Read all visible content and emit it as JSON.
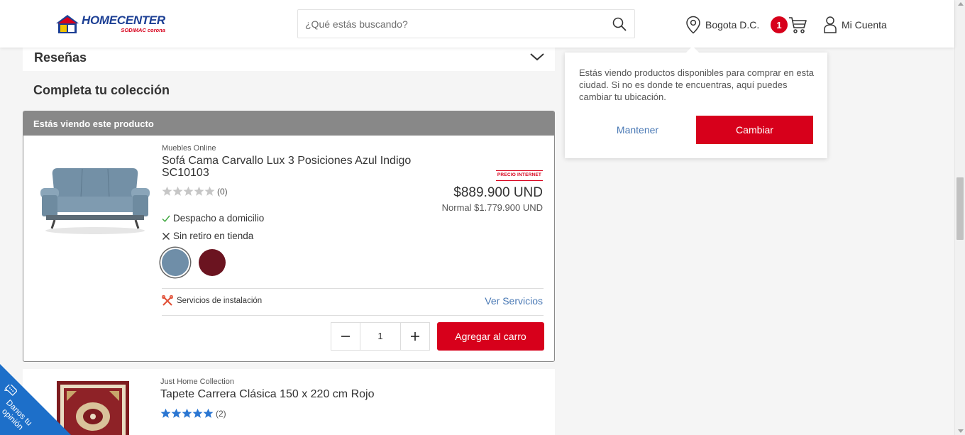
{
  "header": {
    "logo_main": "HOMECENTER",
    "logo_sub": "SODIMAC corona",
    "search_placeholder": "¿Qué estás buscando?",
    "location": "Bogota D.C.",
    "cart_count": "1",
    "account": "Mi Cuenta"
  },
  "sections": {
    "reviews": "Reseñas",
    "collection": "Completa tu colección",
    "viewing_header": "Estás viendo este producto"
  },
  "product1": {
    "brand": "Muebles Online",
    "name": "Sofá Cama Carvallo Lux 3 Posiciones Azul Indigo SC10103",
    "rating": 0,
    "rating_count": "(0)",
    "price_badge": "PRECIO INTERNET",
    "price": "$889.900 UND",
    "normal_price": "Normal $1.779.900  UND",
    "shipping": "Despacho a domicilio",
    "pickup": "Sin retiro en tienda",
    "colors": [
      "#6f8ea8",
      "#6b1420"
    ],
    "selected_color": 0,
    "services_label": "Servicios de instalación",
    "services_link": "Ver Servicios",
    "quantity": "1",
    "add_to_cart": "Agregar al carro"
  },
  "product2": {
    "brand": "Just Home Collection",
    "name": "Tapete Carrera Clásica 150 x 220 cm Rojo",
    "rating": 5,
    "rating_count": "(2)"
  },
  "location_popup": {
    "message": "Estás viendo productos disponibles para comprar en esta ciudad. Si no es donde te encuentras, aquí puedes cambiar tu ubicación.",
    "keep": "Mantener",
    "change": "Cambiar"
  },
  "feedback": {
    "label": "Danos tu opinión"
  },
  "colors": {
    "brand_red": "#d7001b",
    "brand_blue": "#1c3f94",
    "link_blue": "#4a79b5",
    "star_blue": "#2a76d2",
    "star_gray": "#c6c6c6"
  }
}
